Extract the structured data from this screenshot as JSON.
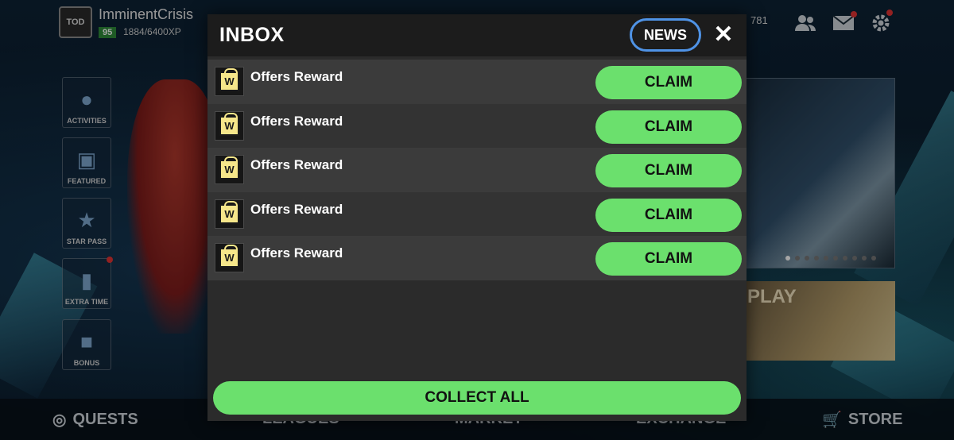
{
  "player": {
    "username": "ImminentCrisis",
    "level": "95",
    "xp": "1884/6400XP",
    "currency": "781"
  },
  "side_menu": [
    {
      "label": "ACTIVITIES"
    },
    {
      "label": "FEATURED"
    },
    {
      "label": "STAR PASS"
    },
    {
      "label": "EXTRA TIME"
    },
    {
      "label": "BONUS"
    }
  ],
  "promo": {
    "play_label": "PLAY"
  },
  "bottom_nav": {
    "quests": "QUESTS",
    "leagues": "LEAGUES",
    "market": "MARKET",
    "exchange": "EXCHANGE",
    "store": "STORE"
  },
  "inbox": {
    "title": "INBOX",
    "news_label": "NEWS",
    "close_glyph": "✕",
    "items": [
      {
        "label": "Offers Reward",
        "action": "CLAIM",
        "icon": "gift-icon"
      },
      {
        "label": "Offers Reward",
        "action": "CLAIM",
        "icon": "gift-icon"
      },
      {
        "label": "Offers Reward",
        "action": "CLAIM",
        "icon": "gift-icon"
      },
      {
        "label": "Offers Reward",
        "action": "CLAIM",
        "icon": "gift-icon"
      },
      {
        "label": "Offers Reward",
        "action": "CLAIM",
        "icon": "gift-icon"
      }
    ],
    "collect_all_label": "COLLECT ALL"
  },
  "colors": {
    "accent_green": "#6be06d",
    "news_border": "#4f93e6",
    "modal_bg": "#2b2b2b",
    "header_bg": "#1c1c1c"
  }
}
